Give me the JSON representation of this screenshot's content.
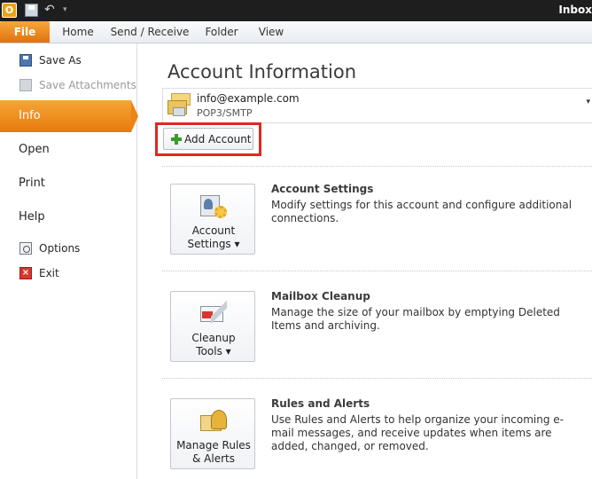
{
  "titlebar": {
    "title": "Inbox"
  },
  "ribbon": {
    "tabs": [
      {
        "label": "File"
      },
      {
        "label": "Home"
      },
      {
        "label": "Send / Receive"
      },
      {
        "label": "Folder"
      },
      {
        "label": "View"
      }
    ]
  },
  "nav": {
    "save_as": "Save As",
    "save_attachments": "Save Attachments",
    "info": "Info",
    "open": "Open",
    "print": "Print",
    "help": "Help",
    "options": "Options",
    "exit": "Exit"
  },
  "main": {
    "heading": "Account Information",
    "account": {
      "email": "info@example.com",
      "type": "POP3/SMTP"
    },
    "add_account": "Add Account",
    "sections": [
      {
        "button_line1": "Account",
        "button_line2": "Settings ▾",
        "title": "Account Settings",
        "description": "Modify settings for this account and configure additional connections."
      },
      {
        "button_line1": "Cleanup",
        "button_line2": "Tools ▾",
        "title": "Mailbox Cleanup",
        "description": "Manage the size of your mailbox by emptying Deleted Items and archiving."
      },
      {
        "button_line1": "Manage Rules",
        "button_line2": "& Alerts",
        "title": "Rules and Alerts",
        "description": "Use Rules and Alerts to help organize your incoming e-mail messages, and receive updates when items are added, changed, or removed."
      }
    ]
  },
  "colors": {
    "accent": "#e87a0d",
    "highlight": "#e0271f"
  }
}
